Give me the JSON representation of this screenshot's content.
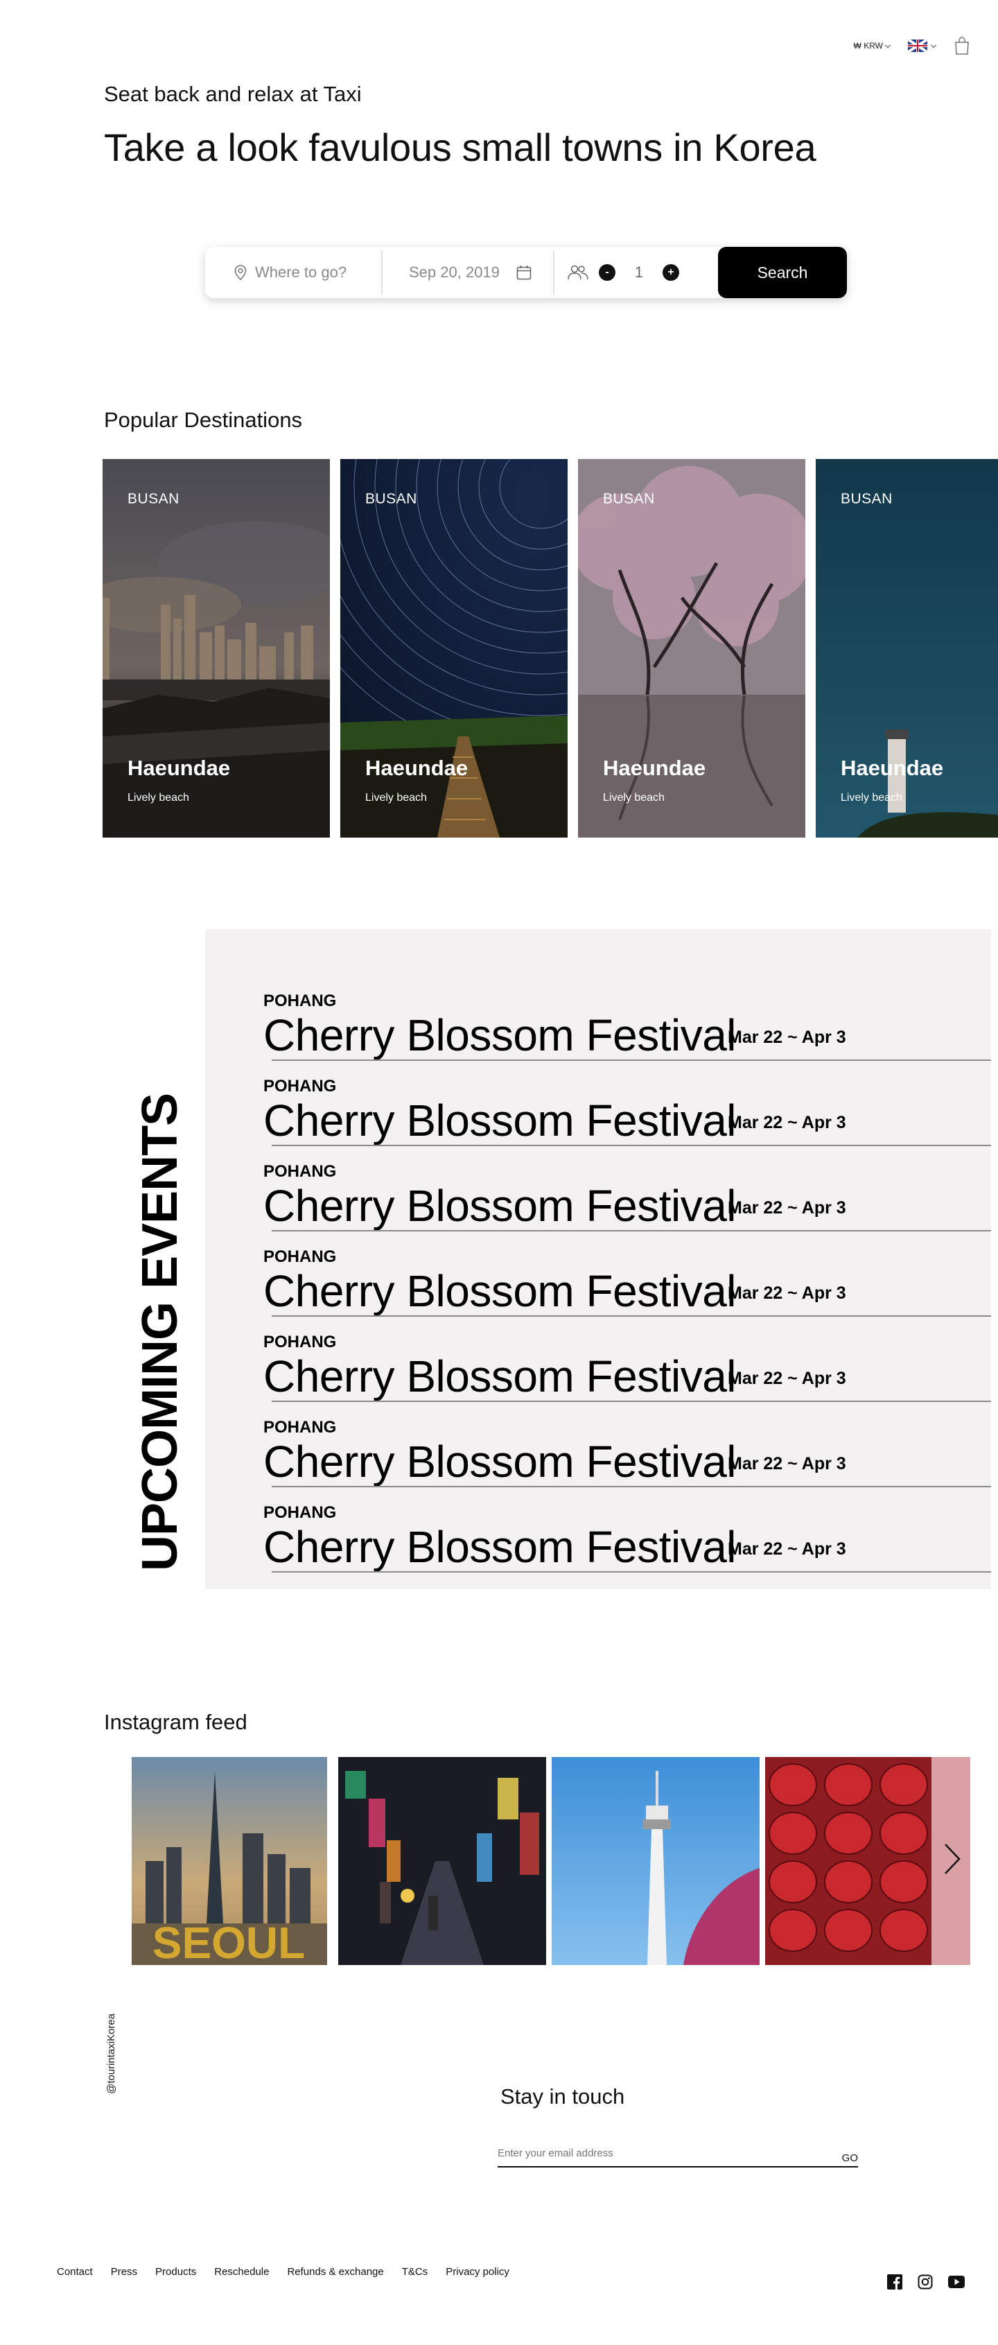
{
  "header": {
    "currency": "₩ KRW",
    "language_flag": "uk-flag-icon",
    "cart_icon": "shopping-bag-icon"
  },
  "hero": {
    "subtitle": "Seat back and relax at Taxi",
    "title": "Take a look favulous small towns in Korea"
  },
  "search": {
    "where_placeholder": "Where to go?",
    "date": "Sep 20, 2019",
    "guests": "1",
    "minus": "-",
    "plus": "+",
    "button_label": "Search"
  },
  "popular": {
    "title": "Popular Destinations",
    "cards": [
      {
        "city": "BUSAN",
        "name": "Haeundae",
        "desc": "Lively beach"
      },
      {
        "city": "BUSAN",
        "name": "Haeundae",
        "desc": "Lively beach"
      },
      {
        "city": "BUSAN",
        "name": "Haeundae",
        "desc": "Lively beach"
      },
      {
        "city": "BUSAN",
        "name": "Haeundae",
        "desc": "Lively beach"
      }
    ]
  },
  "events": {
    "title": "UPCOMING EVENTS",
    "items": [
      {
        "city": "POHANG",
        "name": "Cherry Blossom Festival",
        "date": "Mar 22 ~ Apr 3"
      },
      {
        "city": "POHANG",
        "name": "Cherry Blossom Festival",
        "date": "Mar 22 ~ Apr 3"
      },
      {
        "city": "POHANG",
        "name": "Cherry Blossom Festival",
        "date": "Mar 22 ~ Apr 3"
      },
      {
        "city": "POHANG",
        "name": "Cherry Blossom Festival",
        "date": "Mar 22 ~ Apr 3"
      },
      {
        "city": "POHANG",
        "name": "Cherry Blossom Festival",
        "date": "Mar 22 ~ Apr 3"
      },
      {
        "city": "POHANG",
        "name": "Cherry Blossom Festival",
        "date": "Mar 22 ~ Apr 3"
      },
      {
        "city": "POHANG",
        "name": "Cherry Blossom Festival",
        "date": "Mar 22 ~ Apr 3"
      }
    ]
  },
  "instagram": {
    "title": "Instagram feed",
    "handle": "@tourintaxiKorea",
    "tile1_sign": "SEOUL"
  },
  "newsletter": {
    "title": "Stay in touch",
    "email_placeholder": "Enter your email address",
    "go_label": "GO"
  },
  "footer": {
    "links": [
      "Contact",
      "Press",
      "Products",
      "Reschedule",
      "Refunds & exchange",
      "T&Cs",
      "Privacy policy"
    ],
    "social_icons": [
      "facebook-icon",
      "instagram-icon",
      "youtube-icon"
    ]
  }
}
